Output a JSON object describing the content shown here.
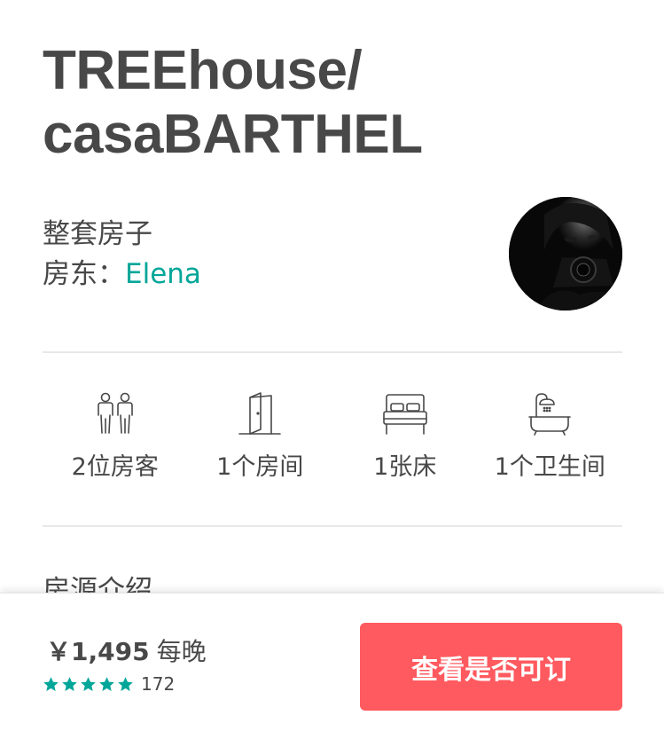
{
  "listing": {
    "title_line1": "TREEhouse/",
    "title_line2": "casaBARTHEL",
    "room_type": "整套房子",
    "host_prefix": "房东：",
    "host_name": "Elena"
  },
  "amenities": [
    {
      "icon": "guests-icon",
      "label": "2位房客"
    },
    {
      "icon": "door-icon",
      "label": "1个房间"
    },
    {
      "icon": "bed-icon",
      "label": "1张床"
    },
    {
      "icon": "bathtub-icon",
      "label": "1个卫生间"
    }
  ],
  "section": {
    "heading": "房源介绍"
  },
  "booking": {
    "currency": "￥",
    "price": "1,495",
    "per_night": "每晚",
    "rating_stars": 5,
    "review_count": "172",
    "cta_label": "查看是否可订"
  },
  "colors": {
    "text": "#484848",
    "accent_teal": "#00a699",
    "cta_red": "#ff5a5f",
    "divider": "#e8e8e8"
  }
}
